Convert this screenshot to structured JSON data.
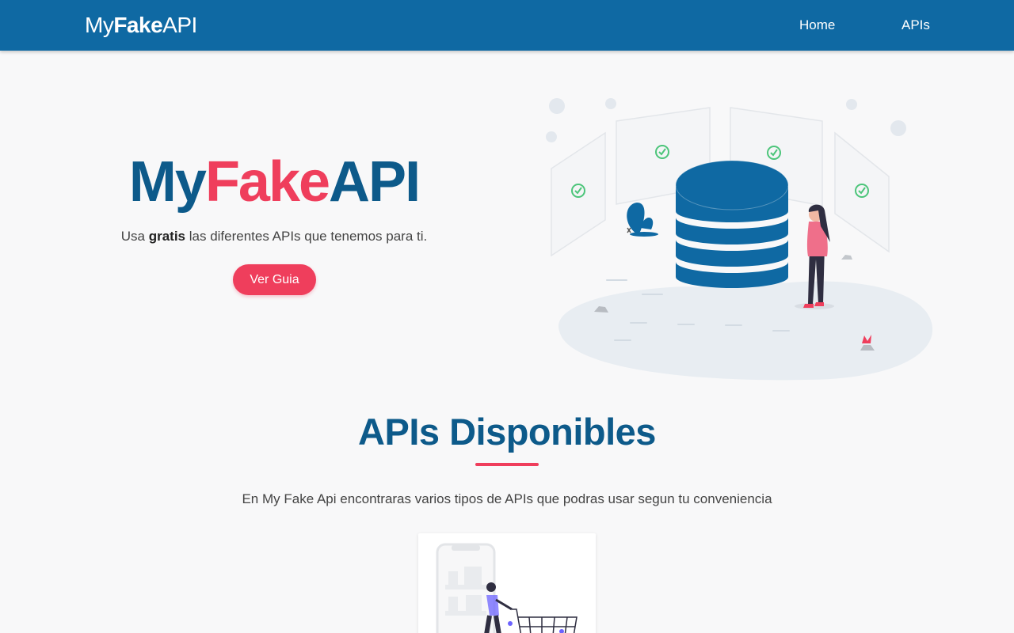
{
  "navbar": {
    "brand_prefix": "My",
    "brand_bold": "Fake",
    "brand_suffix": "API",
    "links": [
      {
        "label": "Home"
      },
      {
        "label": "APIs"
      }
    ],
    "background_color": "#0f69a3"
  },
  "hero": {
    "title_part1": "My",
    "title_part2": "Fake",
    "title_part3": "API",
    "subtitle_prefix": "Usa ",
    "subtitle_bold": "gratis",
    "subtitle_suffix": " las diferentes APIs que tenemos para ti.",
    "button_label": "Ver Guia",
    "accent_color": "#ef3e5c",
    "primary_color": "#0d5a8a"
  },
  "apis_section": {
    "title": "APIs Disponibles",
    "description": "En My Fake Api encontraras varios tipos de APIs que podras usar segun tu conveniencia"
  }
}
